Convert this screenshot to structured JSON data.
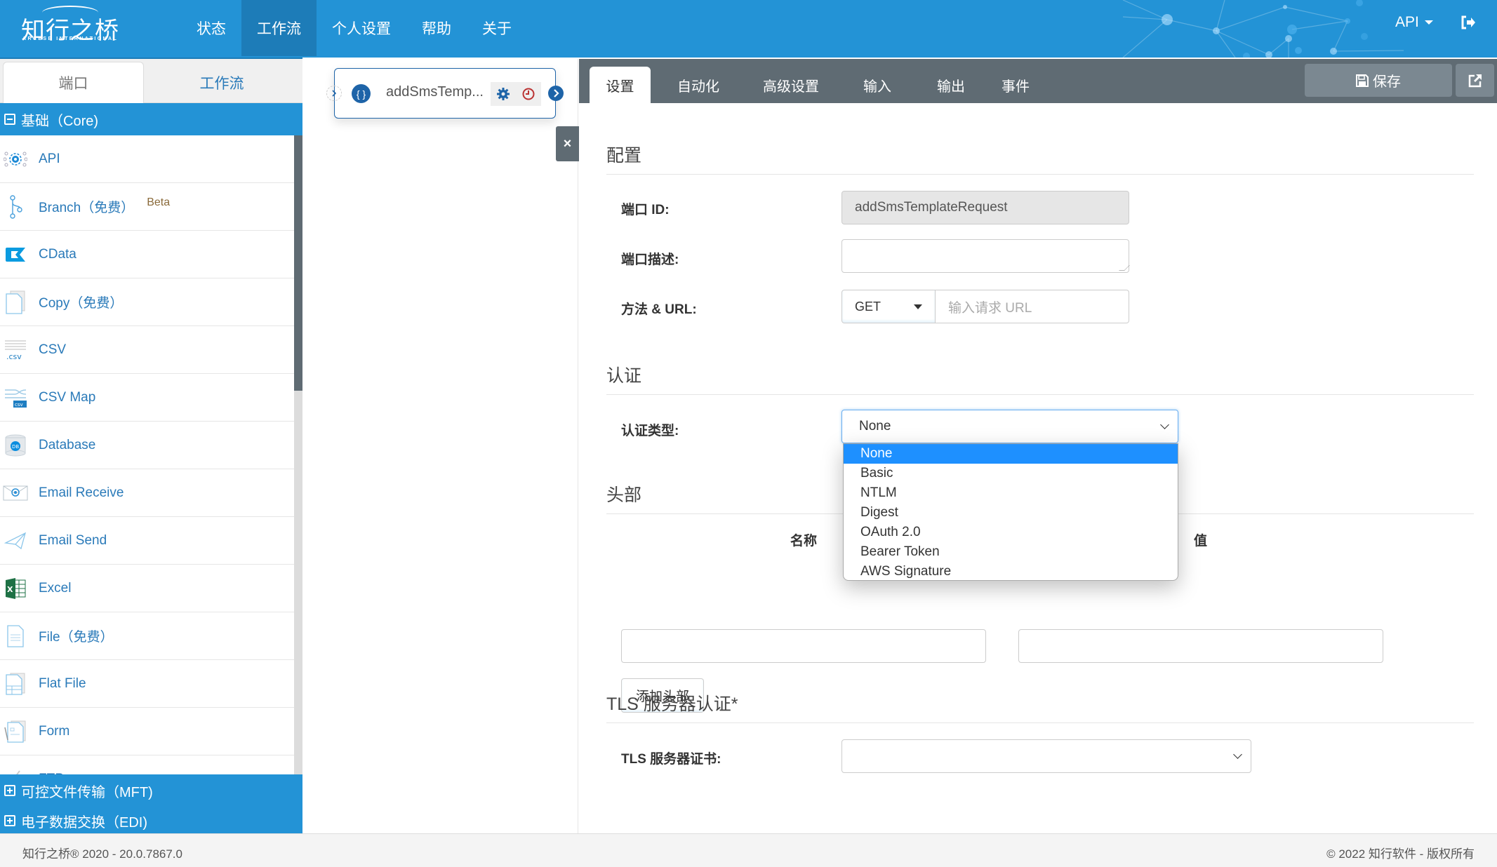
{
  "header": {
    "logo_text": "知行之桥",
    "logo_subtext": "ARCESB INTERNATIONAL",
    "nav": [
      {
        "label": "状态",
        "active": false
      },
      {
        "label": "工作流",
        "active": true
      },
      {
        "label": "个人设置",
        "active": false
      },
      {
        "label": "帮助",
        "active": false
      },
      {
        "label": "关于",
        "active": false
      }
    ],
    "user_menu_label": "API",
    "logout_icon": "sign-out-icon"
  },
  "sidebar": {
    "tabs": [
      {
        "label": "端口",
        "active": true
      },
      {
        "label": "工作流",
        "active": false
      }
    ],
    "groups": [
      {
        "label": "基础（Core)",
        "expanded": true
      },
      {
        "label": "可控文件传输（MFT)",
        "expanded": false
      },
      {
        "label": "电子数据交换（EDI)",
        "expanded": false
      }
    ],
    "items": [
      {
        "label": "API",
        "icon": "api-gear-icon"
      },
      {
        "label": "Branch（免费）",
        "icon": "branch-icon",
        "badge": "Beta"
      },
      {
        "label": "CData",
        "icon": "cdata-icon"
      },
      {
        "label": "Copy（免费）",
        "icon": "copy-file-icon"
      },
      {
        "label": "CSV",
        "icon": "csv-icon"
      },
      {
        "label": "CSV Map",
        "icon": "csv-map-icon"
      },
      {
        "label": "Database",
        "icon": "database-icon"
      },
      {
        "label": "Email Receive",
        "icon": "email-receive-icon"
      },
      {
        "label": "Email Send",
        "icon": "paper-plane-icon"
      },
      {
        "label": "Excel",
        "icon": "excel-icon"
      },
      {
        "label": "File（免费）",
        "icon": "file-icon"
      },
      {
        "label": "Flat File",
        "icon": "flat-file-icon"
      },
      {
        "label": "Form",
        "icon": "form-icon"
      },
      {
        "label": "FTP",
        "icon": "ftp-icon"
      }
    ]
  },
  "canvas": {
    "node": {
      "name": "addSmsTemp...",
      "type_icon_text": "{ }"
    }
  },
  "panel": {
    "tabs": [
      {
        "label": "设置",
        "active": true
      },
      {
        "label": "自动化",
        "active": false
      },
      {
        "label": "高级设置",
        "active": false
      },
      {
        "label": "输入",
        "active": false
      },
      {
        "label": "输出",
        "active": false
      },
      {
        "label": "事件",
        "active": false
      }
    ],
    "save_label": "保存",
    "sections": {
      "config": "配置",
      "auth": "认证",
      "headers": "头部",
      "tls": "TLS 服务器认证*"
    },
    "fields": {
      "port_id_label": "端口 ID:",
      "port_id_value": "addSmsTemplateRequest",
      "port_desc_label": "端口描述:",
      "port_desc_value": "",
      "method_url_label": "方法 & URL:",
      "method_value": "GET",
      "url_placeholder": "输入请求 URL",
      "auth_type_label": "认证类型:",
      "auth_type_value": "None",
      "tls_cert_label": "TLS 服务器证书:",
      "tls_cert_value": ""
    },
    "auth_options": [
      "None",
      "Basic",
      "NTLM",
      "Digest",
      "OAuth 2.0",
      "Bearer Token",
      "AWS Signature"
    ],
    "auth_selected_index": 0,
    "header_table": {
      "name_col": "名称",
      "value_col": "值",
      "add_label": "添加头部"
    }
  },
  "footer": {
    "version": "知行之桥® 2020 - 20.0.7867.0",
    "copyright": "© 2022 知行软件 - 版权所有"
  }
}
